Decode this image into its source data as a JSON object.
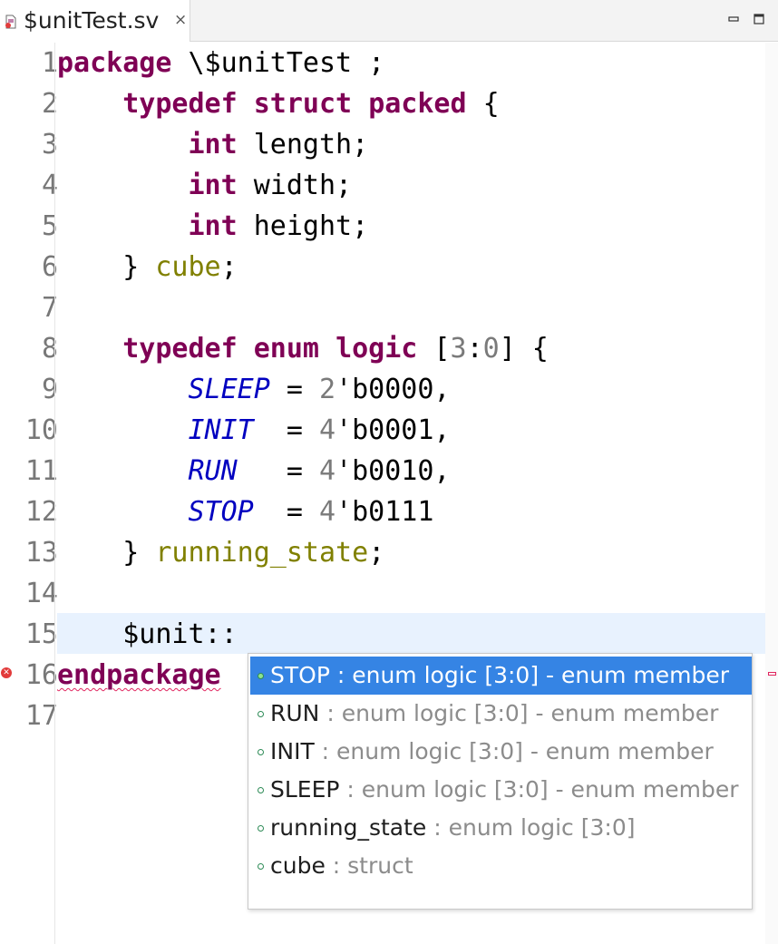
{
  "tab": {
    "title": "$unitTest.sv",
    "close_glyph": "×",
    "file_icon": "sv-file-error-icon"
  },
  "window_controls": {
    "minimize_icon": "minimize-icon",
    "maximize_icon": "maximize-icon"
  },
  "colors": {
    "keyword": "#7f0055",
    "type_name": "#808000",
    "enum_member": "#0000c0",
    "number": "#7a7a7a",
    "current_line": "#e8f2fe",
    "selection": "#3584e4",
    "error": "#e0245e"
  },
  "editor": {
    "line_numbers": [
      "1",
      "2",
      "3",
      "4",
      "5",
      "6",
      "7",
      "8",
      "9",
      "10",
      "11",
      "12",
      "13",
      "14",
      "15",
      "16",
      "17"
    ],
    "lines": {
      "l1": {
        "kw1": "package",
        "rest": " \\$unitTest ;"
      },
      "l2": {
        "indent": "    ",
        "kw1": "typedef",
        "kw2": "struct",
        "kw3": "packed",
        "rest": " {"
      },
      "l3": {
        "indent": "        ",
        "kw1": "int",
        "rest": " length;"
      },
      "l4": {
        "indent": "        ",
        "kw1": "int",
        "rest": " width;"
      },
      "l5": {
        "indent": "        ",
        "kw1": "int",
        "rest": " height;"
      },
      "l6": {
        "indent": "    ",
        "pre": "} ",
        "type": "cube",
        "rest": ";"
      },
      "l8": {
        "indent": "    ",
        "kw1": "typedef",
        "kw2": "enum",
        "kw3": "logic",
        "p1": " [",
        "n1": "3",
        "p2": ":",
        "n2": "0",
        "p3": "] {"
      },
      "l9": {
        "indent": "        ",
        "member": "SLEEP",
        "pad": " = ",
        "width": "2",
        "value": "'b0000,"
      },
      "l10": {
        "indent": "        ",
        "member": "INIT",
        "pad": "  = ",
        "width": "4",
        "value": "'b0001,"
      },
      "l11": {
        "indent": "        ",
        "member": "RUN",
        "pad": "   = ",
        "width": "4",
        "value": "'b0010,"
      },
      "l12": {
        "indent": "        ",
        "member": "STOP",
        "pad": "  = ",
        "width": "4",
        "value": "'b0111"
      },
      "l13": {
        "indent": "    ",
        "pre": "} ",
        "type": "running_state",
        "rest": ";"
      },
      "l15": {
        "indent": "    ",
        "text": "$unit::"
      },
      "l16": {
        "kw1": "endpackage"
      }
    },
    "error_marker_icon": "error-icon"
  },
  "content_assist": {
    "selected_index": 0,
    "proposals": [
      {
        "name": "STOP",
        "detail": " : enum logic [3:0] - enum member"
      },
      {
        "name": "RUN",
        "detail": " : enum logic [3:0] - enum member"
      },
      {
        "name": "INIT",
        "detail": " : enum logic [3:0] - enum member"
      },
      {
        "name": "SLEEP",
        "detail": " : enum logic [3:0] - enum member"
      },
      {
        "name": "running_state",
        "detail": " : enum logic [3:0]"
      },
      {
        "name": "cube",
        "detail": " : struct"
      }
    ]
  }
}
